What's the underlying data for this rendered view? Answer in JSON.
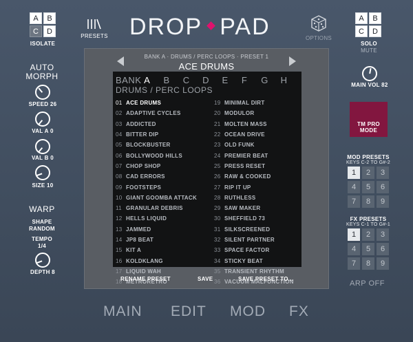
{
  "header": {
    "title_left": "DROP",
    "title_right": "PAD",
    "isolate": {
      "cells": [
        "A",
        "B",
        "C",
        "D"
      ],
      "active": 2,
      "label": "ISOLATE"
    },
    "presets_label": "PRESETS",
    "options_label": "OPTIONS",
    "solo": {
      "cells": [
        "A",
        "B",
        "C",
        "D"
      ],
      "label": "SOLO",
      "sublabel": "MUTE"
    }
  },
  "left": {
    "auto_morph": "AUTO MORPH",
    "knobs": [
      {
        "label": "SPEED 26"
      },
      {
        "label": "VAL A 0"
      },
      {
        "label": "VAL B 0"
      },
      {
        "label": "SIZE 10"
      }
    ],
    "warp": "WARP",
    "shape_label": "SHAPE",
    "shape_value": "RANDOM",
    "tempo_label": "TEMPO",
    "tempo_value": "1/4",
    "depth_label": "DEPTH 8"
  },
  "browser": {
    "bank_info": "BANK A · DRUMS / PERC LOOPS · PRESET 1",
    "preset_name": "ACE DRUMS",
    "bank_word": "BANK",
    "banks": [
      "A",
      "B",
      "C",
      "D",
      "E",
      "F",
      "G",
      "H"
    ],
    "active_bank": 0,
    "category": "DRUMS / PERC LOOPS",
    "presets_col1": [
      {
        "num": "01",
        "name": "ACE DRUMS"
      },
      {
        "num": "02",
        "name": "ADAPTIVE CYCLES"
      },
      {
        "num": "03",
        "name": "ADDICTED"
      },
      {
        "num": "04",
        "name": "BITTER DIP"
      },
      {
        "num": "05",
        "name": "BLOCKBUSTER"
      },
      {
        "num": "06",
        "name": "BOLLYWOOD HILLS"
      },
      {
        "num": "07",
        "name": "CHOP SHOP"
      },
      {
        "num": "08",
        "name": "CAD ERRORS"
      },
      {
        "num": "09",
        "name": "FOOTSTEPS"
      },
      {
        "num": "10",
        "name": "GIANT GOOMBA ATTACK"
      },
      {
        "num": "11",
        "name": "GRANULAR DEBRIS"
      },
      {
        "num": "12",
        "name": "HELLS LIQUID"
      },
      {
        "num": "13",
        "name": "JAMMED"
      },
      {
        "num": "14",
        "name": "JP8 BEAT"
      },
      {
        "num": "15",
        "name": "KIT A"
      },
      {
        "num": "16",
        "name": "KOLDKLANG"
      },
      {
        "num": "17",
        "name": "LIQUID WAH"
      },
      {
        "num": "18",
        "name": "METRORETRO"
      }
    ],
    "presets_col2": [
      {
        "num": "19",
        "name": "MINIMAL DIRT"
      },
      {
        "num": "20",
        "name": "MODULOR"
      },
      {
        "num": "21",
        "name": "MOLTEN MASS"
      },
      {
        "num": "22",
        "name": "OCEAN DRIVE"
      },
      {
        "num": "23",
        "name": "OLD FUNK"
      },
      {
        "num": "24",
        "name": "PREMIER BEAT"
      },
      {
        "num": "25",
        "name": "PRESS RESET"
      },
      {
        "num": "26",
        "name": "RAW & COOKED"
      },
      {
        "num": "27",
        "name": "RIP IT UP"
      },
      {
        "num": "28",
        "name": "RUTHLESS"
      },
      {
        "num": "29",
        "name": "SAW MAKER"
      },
      {
        "num": "30",
        "name": "SHEFFIELD 73"
      },
      {
        "num": "31",
        "name": "SILKSCREENED"
      },
      {
        "num": "32",
        "name": "SILENT PARTNER"
      },
      {
        "num": "33",
        "name": "SPACE FACTOR"
      },
      {
        "num": "34",
        "name": "STICKY BEAT"
      },
      {
        "num": "35",
        "name": "TRANSIENT RHYTHM"
      },
      {
        "num": "36",
        "name": "VACUUM MALFUNCTION"
      }
    ],
    "rename": "RENAME PRESET",
    "save": "SAVE",
    "save_to": "SAVE PRESET TO..."
  },
  "right": {
    "main_vol": "MAIN VOL 82",
    "tm_line1": "TM PRO",
    "tm_line2": "MODE",
    "mod_title": "MOD PRESETS",
    "mod_sub": "KEYS C-2 TO G#-2",
    "fx_title": "FX PRESETS",
    "fx_sub": "KEYS C-1 TO G#-1",
    "grid": [
      "1",
      "2",
      "3",
      "4",
      "5",
      "6",
      "7",
      "8",
      "9"
    ],
    "arp": "ARP OFF"
  },
  "tabs": [
    "MAIN",
    "EDIT",
    "MOD",
    "FX"
  ]
}
